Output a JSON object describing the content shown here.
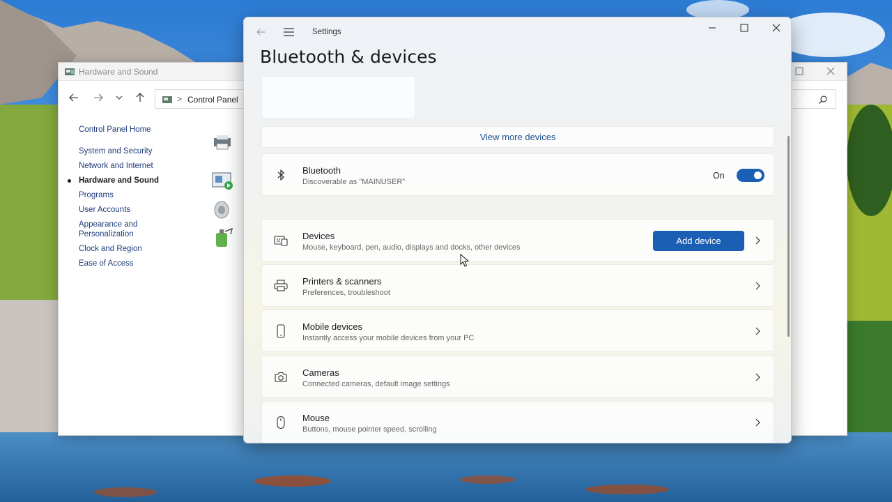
{
  "control_panel": {
    "title": "Hardware and Sound",
    "address": {
      "separator": ">",
      "path": "Control Panel"
    },
    "sidebar": {
      "home": "Control Panel Home",
      "items": [
        {
          "label": "System and Security"
        },
        {
          "label": "Network and Internet"
        },
        {
          "label": "Hardware and Sound",
          "active": true
        },
        {
          "label": "Programs"
        },
        {
          "label": "User Accounts"
        },
        {
          "label": "Appearance and Personalization"
        },
        {
          "label": "Clock and Region"
        },
        {
          "label": "Ease of Access"
        }
      ]
    }
  },
  "settings": {
    "app_title": "Settings",
    "page_title": "Bluetooth & devices",
    "view_more": "View more devices",
    "bluetooth": {
      "title": "Bluetooth",
      "subtitle": "Discoverable as \"MAINUSER\"",
      "state_label": "On",
      "enabled": true
    },
    "devices": {
      "title": "Devices",
      "subtitle": "Mouse, keyboard, pen, audio, displays and docks, other devices",
      "button": "Add device"
    },
    "printers": {
      "title": "Printers & scanners",
      "subtitle": "Preferences, troubleshoot"
    },
    "mobile": {
      "title": "Mobile devices",
      "subtitle": "Instantly access your mobile devices from your PC"
    },
    "cameras": {
      "title": "Cameras",
      "subtitle": "Connected cameras, default image settings"
    },
    "mouse": {
      "title": "Mouse",
      "subtitle": "Buttons, mouse pointer speed, scrolling"
    }
  },
  "colors": {
    "accent": "#1a5fb4",
    "link": "#1f3c7a"
  }
}
